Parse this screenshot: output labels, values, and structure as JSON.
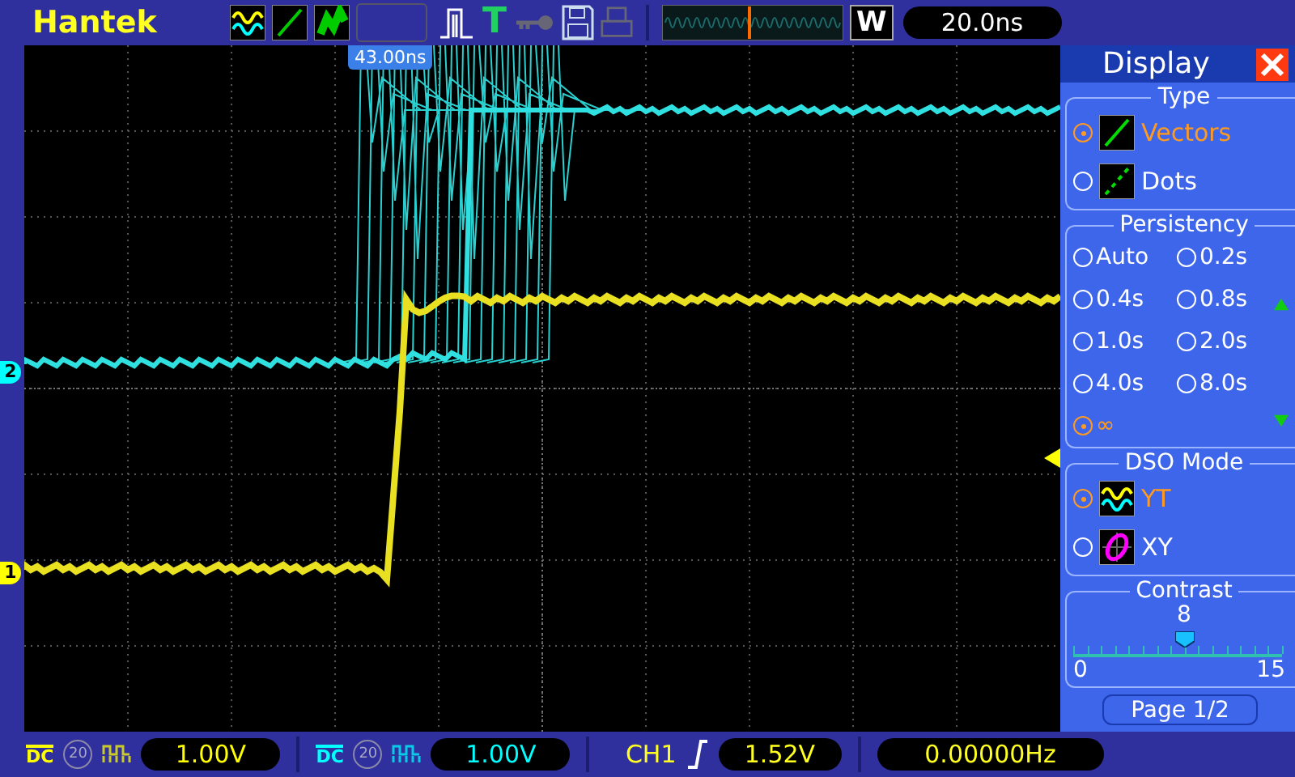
{
  "header": {
    "brand": "Hantek",
    "trigger_letter": "T",
    "zoom_key": "W",
    "timebase": "20.0ns"
  },
  "screen": {
    "trigger_time": "43.00ns",
    "channel_markers": [
      {
        "label": "2",
        "color": "#00ffff"
      },
      {
        "label": "1",
        "color": "#ffff00"
      }
    ]
  },
  "panel": {
    "title": "Display",
    "type": {
      "title": "Type",
      "options": [
        {
          "label": "Vectors",
          "selected": true,
          "kind": "vectors"
        },
        {
          "label": "Dots",
          "selected": false,
          "kind": "dots"
        }
      ]
    },
    "persistency": {
      "title": "Persistency",
      "options": [
        {
          "label": "Auto",
          "selected": false
        },
        {
          "label": "0.2s",
          "selected": false
        },
        {
          "label": "0.4s",
          "selected": false
        },
        {
          "label": "0.8s",
          "selected": false
        },
        {
          "label": "1.0s",
          "selected": false
        },
        {
          "label": "2.0s",
          "selected": false
        },
        {
          "label": "4.0s",
          "selected": false
        },
        {
          "label": "8.0s",
          "selected": false
        },
        {
          "label": "∞",
          "selected": true
        }
      ]
    },
    "mode": {
      "title": "DSO Mode",
      "options": [
        {
          "label": "YT",
          "selected": true,
          "kind": "yt"
        },
        {
          "label": "XY",
          "selected": false,
          "kind": "xy"
        }
      ]
    },
    "contrast": {
      "title": "Contrast",
      "value": "8",
      "level": 0.533,
      "min": "0",
      "max": "15"
    },
    "page": "Page 1/2"
  },
  "status": {
    "channels": [
      {
        "coupling": "DC",
        "bandwidth": "20",
        "scale": "1.00V",
        "color": "#ffff00"
      },
      {
        "coupling": "DC",
        "bandwidth": "20",
        "scale": "1.00V",
        "color": "#00ffff"
      }
    ],
    "trigger": {
      "source": "CH1",
      "level": "1.52V"
    },
    "frequency": "0.00000Hz"
  }
}
